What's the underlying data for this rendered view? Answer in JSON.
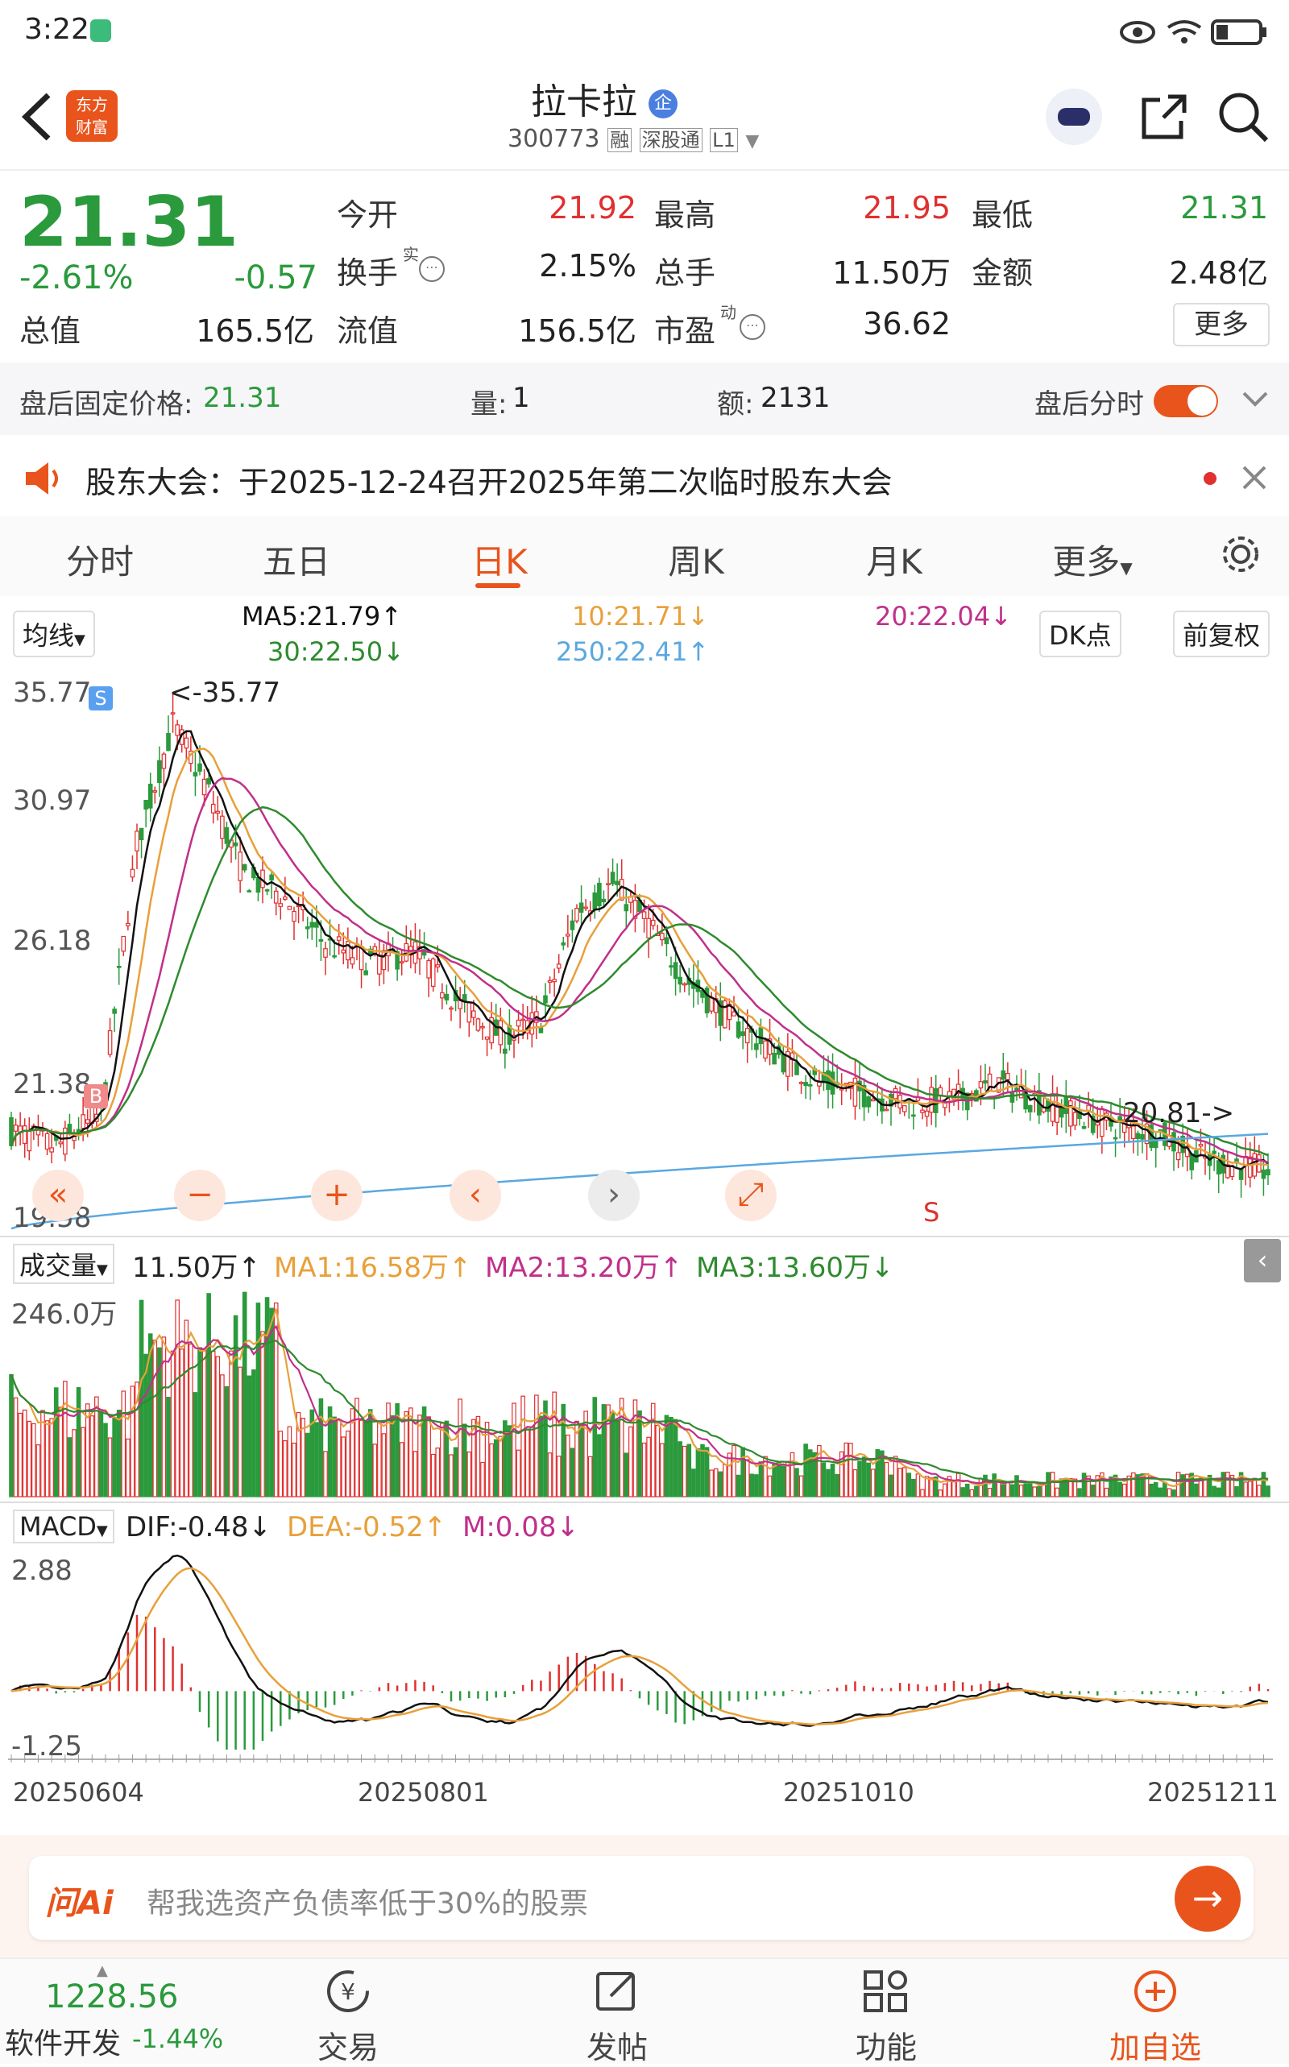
{
  "status": {
    "time": "3:22"
  },
  "header": {
    "title": "拉卡拉",
    "badge": "企",
    "code": "300773",
    "tag_rong": "融",
    "tag_sgt": "深股通",
    "tag_l1": "L1",
    "logo_line1": "东方",
    "logo_line2": "财富"
  },
  "quote": {
    "price": "21.31",
    "change_pct": "-2.61%",
    "change": "-0.57",
    "open_label": "今开",
    "open": "21.92",
    "high_label": "最高",
    "high": "21.95",
    "low_label": "最低",
    "low": "21.31",
    "turnover_label": "换手",
    "turnover_sup": "实",
    "turnover": "2.15%",
    "volume_label": "总手",
    "volume": "11.50万",
    "amount_label": "金额",
    "amount": "2.48亿",
    "mktcap_label": "总值",
    "mktcap": "165.5亿",
    "float_label": "流值",
    "float": "156.5亿",
    "pe_label": "市盈",
    "pe_sup": "动",
    "pe": "36.62",
    "more": "更多"
  },
  "afterhours": {
    "price_label": "盘后固定价格:",
    "price": "21.31",
    "vol_label": "量:",
    "vol": "1",
    "amt_label": "额:",
    "amt": "2131",
    "toggle_label": "盘后分时"
  },
  "notice": {
    "text": "股东大会：于2025-12-24召开2025年第二次临时股东大会"
  },
  "tabs": [
    "分时",
    "五日",
    "日K",
    "周K",
    "月K",
    "更多"
  ],
  "ma_legend": {
    "selector": "均线",
    "ma5": "MA5:21.79↑",
    "ma10": "10:21.71↓",
    "ma20": "20:22.04↓",
    "ma30": "30:22.50↓",
    "ma250": "250:22.41↑",
    "dk": "DK点",
    "fq": "前复权"
  },
  "kline_axis": {
    "y_top": "35.77",
    "y2": "30.97",
    "y3": "26.18",
    "y4": "21.38",
    "y_bottom": "19.58",
    "max_label": "<-35.77",
    "min_label": "20.81->",
    "s_mark": "S",
    "b_mark": "B"
  },
  "volume_legend": {
    "selector": "成交量",
    "vol": "11.50万↑",
    "ma1": "MA1:16.58万↑",
    "ma2": "MA2:13.20万↑",
    "ma3": "MA3:13.60万↓",
    "y_top": "246.0万"
  },
  "macd_legend": {
    "selector": "MACD",
    "dif": "DIF:-0.48↓",
    "dea": "DEA:-0.52↑",
    "m": "M:0.08↓",
    "y_top": "2.88",
    "y_bottom": "-1.25"
  },
  "dates": [
    "20250604",
    "20250801",
    "20251010",
    "20251211"
  ],
  "ai_bar": {
    "logo": "问Ai",
    "placeholder": "帮我选资产负债率低于30%的股票"
  },
  "bottom": {
    "index_value": "1228.56",
    "index_name": "软件开发",
    "index_change": "-1.44%",
    "trade": "交易",
    "post": "发帖",
    "func": "功能",
    "add": "加自选"
  },
  "colors": {
    "up": "#e03030",
    "down": "#2a9a3c",
    "accent": "#e8541c",
    "ma5": "#111111",
    "ma10": "#e8a03a",
    "ma20": "#c0308a",
    "ma30": "#2e8b2e",
    "ma250": "#5aa8e0"
  }
}
